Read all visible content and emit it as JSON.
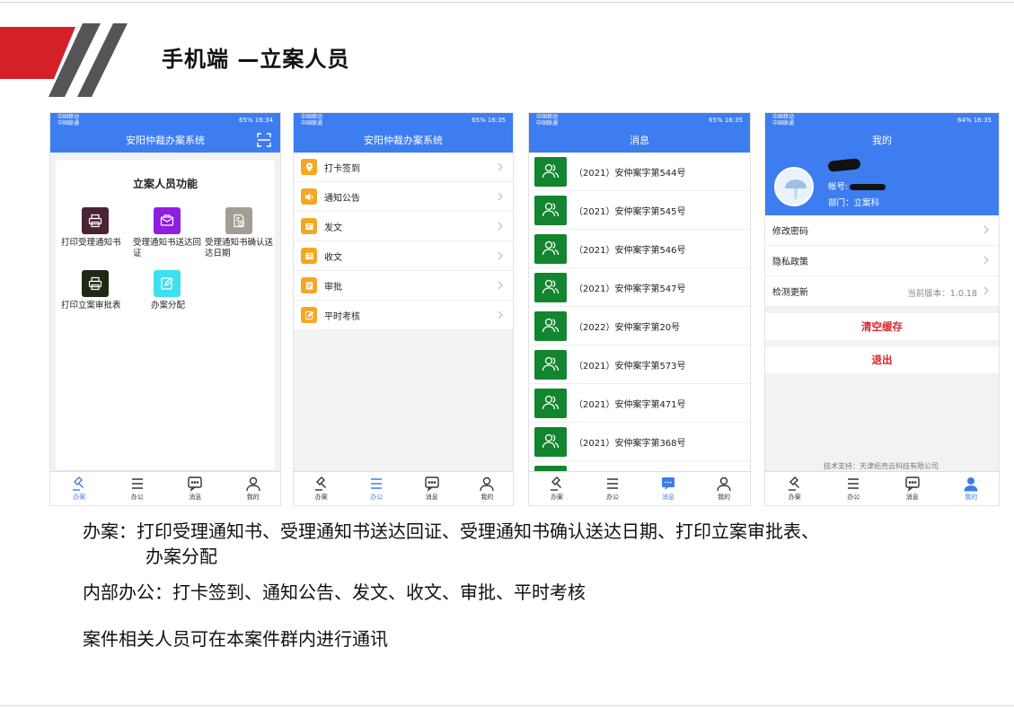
{
  "slide": {
    "title": "手机端 —立案人员",
    "bullets": {
      "b1_line1": "办案：打印受理通知书、受理通知书送达回证、受理通知书确认送达日期、打印立案审批表、",
      "b1_line2": "办案分配",
      "b2": "内部办公：打卡签到、通知公告、发文、收文、审批、平时考核",
      "b3": "案件相关人员可在本案件群内进行通讯"
    }
  },
  "colors": {
    "primary": "#3d7df0",
    "deco_red": "#d42027",
    "deco_gray": "#555555",
    "avatar_green": "#13852e",
    "danger": "#d9262b"
  },
  "phone1": {
    "status": {
      "carrier1": "中国移动",
      "carrier2": "中国联通",
      "right": "65% 16:34"
    },
    "appbar_title": "安阳仲裁办案系统",
    "card_title": "立案人员功能",
    "functions": [
      {
        "label": "打印受理通知书",
        "color": "#4a2335",
        "icon": "printer-icon"
      },
      {
        "label": "受理通知书送达回证",
        "color": "#8e1ee0",
        "icon": "envelope-icon"
      },
      {
        "label": "受理通知书确认送达日期",
        "color": "#a39d96",
        "icon": "document-clock-icon"
      },
      {
        "label": "打印立案审批表",
        "color": "#1f2a12",
        "icon": "printer-icon"
      },
      {
        "label": "办案分配",
        "color": "#3ee0ef",
        "icon": "edit-icon"
      }
    ],
    "tabs": [
      "办案",
      "办公",
      "消息",
      "我的"
    ]
  },
  "phone2": {
    "status": {
      "carrier1": "中国移动",
      "carrier2": "中国联通",
      "right": "65% 16:35"
    },
    "appbar_title": "安阳仲裁办案系统",
    "items": [
      "打卡签到",
      "通知公告",
      "发文",
      "收文",
      "审批",
      "平时考核"
    ],
    "tabs": [
      "办案",
      "办公",
      "消息",
      "我的"
    ]
  },
  "phone3": {
    "status": {
      "carrier1": "中国移动",
      "carrier2": "中国联通",
      "right": "65% 16:35"
    },
    "appbar_title": "消息",
    "messages": [
      "（2021）安仲案字第544号",
      "（2021）安仲案字第545号",
      "（2021）安仲案字第546号",
      "（2021）安仲案字第547号",
      "（2022）安仲案字第20号",
      "（2021）安仲案字第573号",
      "（2021）安仲案字第471号",
      "（2021）安仲案字第368号"
    ],
    "tabs": [
      "办案",
      "办公",
      "消息",
      "我的"
    ]
  },
  "phone4": {
    "status": {
      "carrier1": "中国移动",
      "carrier2": "中国联通",
      "right": "64% 16:35"
    },
    "appbar_title": "我的",
    "account_label": "帐号:",
    "dept": "部门：立案科",
    "rows": [
      "修改密码",
      "隐私政策",
      "检测更新"
    ],
    "version": "当前版本：1.0.18",
    "clear_cache": "清空缓存",
    "logout": "退出",
    "support": "技术支持：天津拓壳云科技有限公司",
    "tabs": [
      "办案",
      "办公",
      "消息",
      "我的"
    ]
  }
}
